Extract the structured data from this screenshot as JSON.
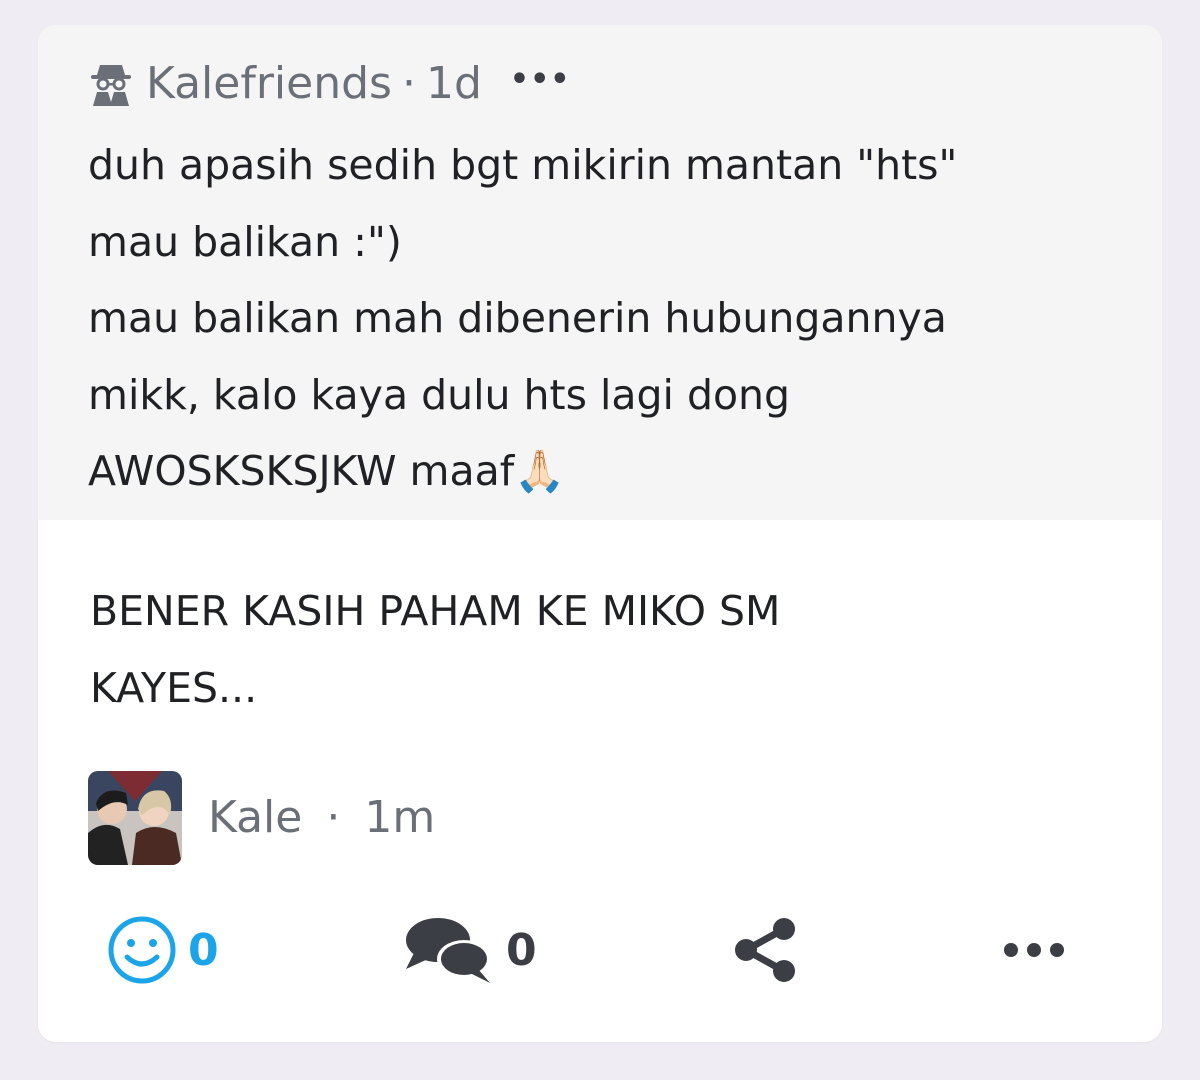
{
  "quoted_post": {
    "author": "Kalefriends",
    "separator": "·",
    "time": "1d",
    "more_label": "•••",
    "text": "duh apasih sedih bgt mikirin mantan \"hts\"\nmau balikan :\")\nmau balikan mah dibenerin hubungannya\nmikk, kalo kaya dulu hts lagi dong\nAWOSKSKSJKW maaf🙏🏻",
    "icon": "anonymous-spy-icon"
  },
  "reply": {
    "text": "BENER KASIH PAHAM KE MIKO SM\nKAYES...",
    "author": "Kale",
    "separator": "·",
    "time": "1m",
    "avatar": "profile-photo-avatar"
  },
  "actions": {
    "reactions_count": "0",
    "comments_count": "0",
    "react_icon": "smiley-icon",
    "comment_icon": "chat-bubbles-icon",
    "share_icon": "share-icon",
    "more_icon": "more-dots-icon"
  },
  "colors": {
    "background": "#efedf3",
    "card": "#ffffff",
    "quoted_background": "#f5f5f6",
    "meta_text": "#6b7078",
    "body_text": "#202124",
    "accent_blue": "#1ba4e8",
    "icon_dark": "#3b3f45"
  }
}
